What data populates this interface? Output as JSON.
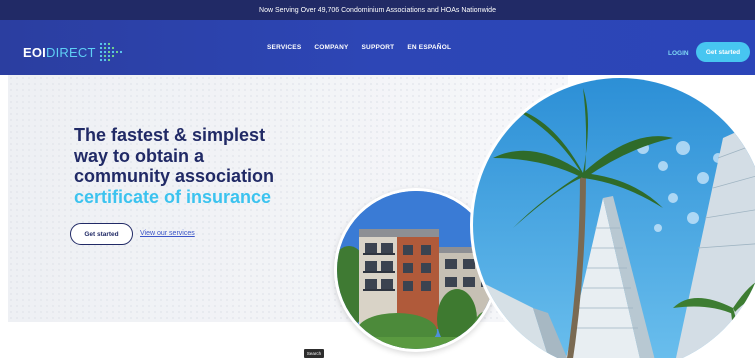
{
  "announcement": "Now Serving Over 49,706 Condominium Associations and HOAs Nationwide",
  "logo": {
    "part1": "EOI",
    "part2": "DIRECT",
    "mark_icon": "arrow-dots-icon"
  },
  "nav": {
    "items": [
      "SERVICES",
      "COMPANY",
      "SUPPORT",
      "EN ESPAÑOL"
    ]
  },
  "header": {
    "login": "LOGIN",
    "cta": "Get started"
  },
  "hero": {
    "line1": "The fastest & simplest",
    "line2": "way to obtain a",
    "line3": "community association",
    "accent": "certificate of insurance",
    "cta": "Get started",
    "link": "View our services"
  },
  "images": {
    "small": "apartment-building-photo",
    "large": "palm-tree-skyscraper-photo"
  },
  "tooltip": "Search",
  "colors": {
    "navy": "#212a66",
    "nav_blue": "#2d46b6",
    "accent": "#3cc3ef",
    "button_cyan": "#47c6f1"
  }
}
